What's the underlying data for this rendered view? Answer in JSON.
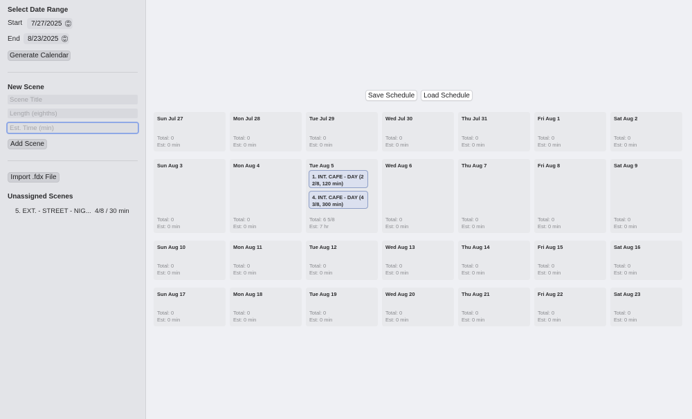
{
  "sidebar": {
    "date_range": {
      "heading": "Select Date Range",
      "start_label": "Start",
      "start_value": "7/27/2025",
      "end_label": "End",
      "end_value": "8/23/2025",
      "generate_label": "Generate Calendar"
    },
    "new_scene": {
      "heading": "New Scene",
      "title_placeholder": "Scene Title",
      "length_placeholder": "Length (eighths)",
      "time_placeholder": "Est. Time (min)",
      "add_label": "Add Scene"
    },
    "import_label": "Import .fdx File",
    "unassigned": {
      "heading": "Unassigned Scenes",
      "items": [
        {
          "title": "5. EXT. - STREET - NIG...",
          "meta": "4/8 / 30 min"
        }
      ]
    }
  },
  "toolbar": {
    "save_label": "Save Schedule",
    "load_label": "Load Schedule"
  },
  "calendar": {
    "weeks": [
      {
        "days": [
          {
            "title": "Sun Jul 27",
            "total": "Total: 0",
            "est": "Est: 0 min",
            "scenes": []
          },
          {
            "title": "Mon Jul 28",
            "total": "Total: 0",
            "est": "Est: 0 min",
            "scenes": []
          },
          {
            "title": "Tue Jul 29",
            "total": "Total: 0",
            "est": "Est: 0 min",
            "scenes": []
          },
          {
            "title": "Wed Jul 30",
            "total": "Total: 0",
            "est": "Est: 0 min",
            "scenes": []
          },
          {
            "title": "Thu Jul 31",
            "total": "Total: 0",
            "est": "Est: 0 min",
            "scenes": []
          },
          {
            "title": "Fri Aug 1",
            "total": "Total: 0",
            "est": "Est: 0 min",
            "scenes": []
          },
          {
            "title": "Sat Aug 2",
            "total": "Total: 0",
            "est": "Est: 0 min",
            "scenes": []
          }
        ]
      },
      {
        "days": [
          {
            "title": "Sun Aug 3",
            "total": "Total: 0",
            "est": "Est: 0 min",
            "scenes": []
          },
          {
            "title": "Mon Aug 4",
            "total": "Total: 0",
            "est": "Est: 0 min",
            "scenes": []
          },
          {
            "title": "Tue Aug 5",
            "total": "Total: 6 5/8",
            "est": "Est: 7 hr",
            "scenes": [
              {
                "line1": "1. INT. CAFE - DAY (2",
                "line2": "2/8, 120 min)"
              },
              {
                "line1": "4. INT. CAFE - DAY (4",
                "line2": "3/8, 300 min)"
              }
            ]
          },
          {
            "title": "Wed Aug 6",
            "total": "Total: 0",
            "est": "Est: 0 min",
            "scenes": []
          },
          {
            "title": "Thu Aug 7",
            "total": "Total: 0",
            "est": "Est: 0 min",
            "scenes": []
          },
          {
            "title": "Fri Aug 8",
            "total": "Total: 0",
            "est": "Est: 0 min",
            "scenes": []
          },
          {
            "title": "Sat Aug 9",
            "total": "Total: 0",
            "est": "Est: 0 min",
            "scenes": []
          }
        ]
      },
      {
        "days": [
          {
            "title": "Sun Aug 10",
            "total": "Total: 0",
            "est": "Est: 0 min",
            "scenes": []
          },
          {
            "title": "Mon Aug 11",
            "total": "Total: 0",
            "est": "Est: 0 min",
            "scenes": []
          },
          {
            "title": "Tue Aug 12",
            "total": "Total: 0",
            "est": "Est: 0 min",
            "scenes": []
          },
          {
            "title": "Wed Aug 13",
            "total": "Total: 0",
            "est": "Est: 0 min",
            "scenes": []
          },
          {
            "title": "Thu Aug 14",
            "total": "Total: 0",
            "est": "Est: 0 min",
            "scenes": []
          },
          {
            "title": "Fri Aug 15",
            "total": "Total: 0",
            "est": "Est: 0 min",
            "scenes": []
          },
          {
            "title": "Sat Aug 16",
            "total": "Total: 0",
            "est": "Est: 0 min",
            "scenes": []
          }
        ]
      },
      {
        "days": [
          {
            "title": "Sun Aug 17",
            "total": "Total: 0",
            "est": "Est: 0 min",
            "scenes": []
          },
          {
            "title": "Mon Aug 18",
            "total": "Total: 0",
            "est": "Est: 0 min",
            "scenes": []
          },
          {
            "title": "Tue Aug 19",
            "total": "Total: 0",
            "est": "Est: 0 min",
            "scenes": []
          },
          {
            "title": "Wed Aug 20",
            "total": "Total: 0",
            "est": "Est: 0 min",
            "scenes": []
          },
          {
            "title": "Thu Aug 21",
            "total": "Total: 0",
            "est": "Est: 0 min",
            "scenes": []
          },
          {
            "title": "Fri Aug 22",
            "total": "Total: 0",
            "est": "Est: 0 min",
            "scenes": []
          },
          {
            "title": "Sat Aug 23",
            "total": "Total: 0",
            "est": "Est: 0 min",
            "scenes": []
          }
        ]
      }
    ]
  }
}
